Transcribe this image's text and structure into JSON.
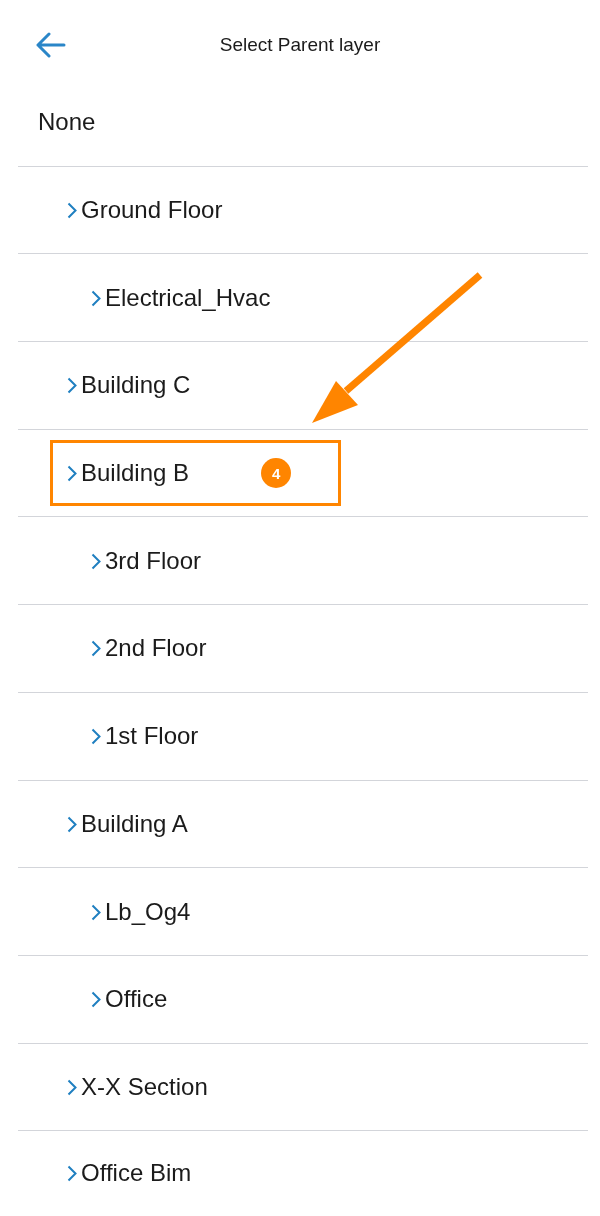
{
  "header": {
    "title": "Select Parent layer"
  },
  "list": {
    "none_option": "None",
    "items": [
      {
        "label": "Ground Floor",
        "highlighted": false,
        "children": [
          {
            "label": "Electrical_Hvac",
            "highlighted": false
          }
        ]
      },
      {
        "label": "Building C",
        "highlighted": false
      },
      {
        "label": "Building B",
        "highlighted": true,
        "badge": "4",
        "children": [
          {
            "label": "3rd Floor",
            "highlighted": false
          },
          {
            "label": "2nd Floor",
            "highlighted": false
          },
          {
            "label": "1st Floor",
            "highlighted": false
          }
        ]
      },
      {
        "label": "Building A",
        "highlighted": false,
        "children": [
          {
            "label": "Lb_Og4",
            "highlighted": false
          },
          {
            "label": "Office",
            "highlighted": false
          }
        ]
      },
      {
        "label": "X-X Section",
        "highlighted": false
      },
      {
        "label": "Office Bim",
        "highlighted": false
      }
    ]
  }
}
